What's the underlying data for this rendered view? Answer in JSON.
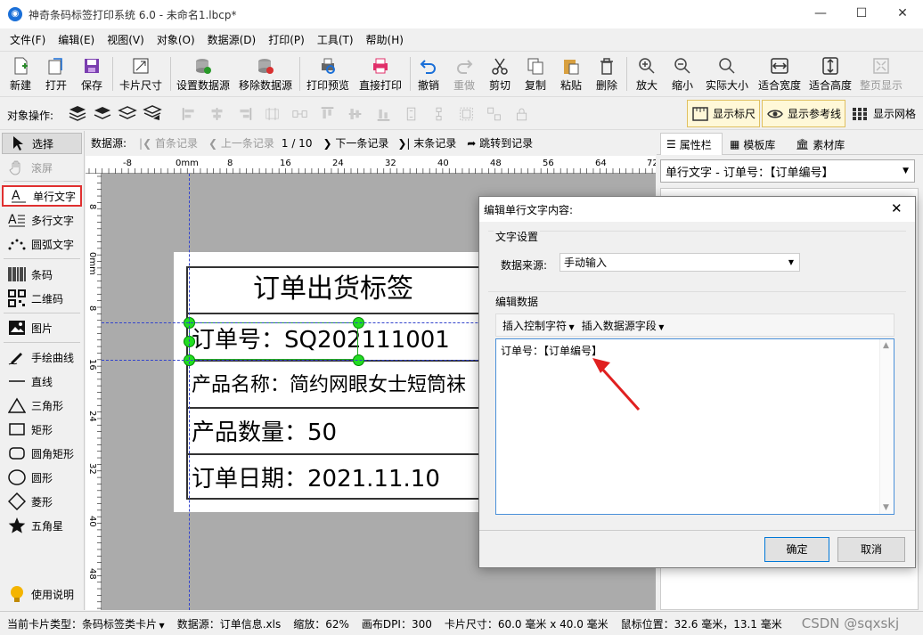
{
  "window": {
    "title": "神奇条码标签打印系统 6.0 - 未命名1.lbcp*",
    "minimize": "—",
    "maximize": "☐",
    "close": "✕"
  },
  "menu": [
    "文件(F)",
    "编辑(E)",
    "视图(V)",
    "对象(O)",
    "数据源(D)",
    "打印(P)",
    "工具(T)",
    "帮助(H)"
  ],
  "toolbar": {
    "new": "新建",
    "open": "打开",
    "save": "保存",
    "card_size": "卡片尺寸",
    "set_ds": "设置数据源",
    "remove_ds": "移除数据源",
    "print_preview": "打印预览",
    "direct_print": "直接打印",
    "undo": "撤销",
    "redo": "重做",
    "cut": "剪切",
    "copy": "复制",
    "paste": "粘贴",
    "delete": "删除",
    "zoom_in": "放大",
    "zoom_out": "缩小",
    "actual_size": "实际大小",
    "fit_width": "适合宽度",
    "fit_height": "适合高度",
    "fit_page": "整页显示"
  },
  "toolbar2": {
    "obj_ops": "对象操作:",
    "show_ruler": "显示标尺",
    "show_guides": "显示参考线",
    "show_grid": "显示网格"
  },
  "tools": {
    "select": "选择",
    "pan": "滚屏",
    "single_text": "单行文字",
    "multi_text": "多行文字",
    "arc_text": "圆弧文字",
    "barcode": "条码",
    "qrcode": "二维码",
    "image": "图片",
    "freehand": "手绘曲线",
    "line": "直线",
    "triangle": "三角形",
    "rect": "矩形",
    "round_rect": "圆角矩形",
    "circle": "圆形",
    "diamond": "菱形",
    "star": "五角星",
    "help": "使用说明"
  },
  "nav": {
    "ds_label": "数据源:",
    "first": "首条记录",
    "prev": "上一条记录",
    "page": "1 / 10",
    "next": "下一条记录",
    "last": "末条记录",
    "jump": "跳转到记录"
  },
  "hruler": {
    "unit": "0mm",
    "ticks": [
      "-8",
      "0mm",
      "8",
      "16",
      "24",
      "32",
      "40",
      "48",
      "56",
      "64",
      "72"
    ]
  },
  "vruler": {
    "unit": "0mm",
    "ticks": [
      "8",
      "0mm",
      "8",
      "16",
      "24",
      "32",
      "40",
      "48"
    ]
  },
  "label": {
    "title": "订单出货标签",
    "order": "订单号：SQ202111001",
    "product": "产品名称：简约网眼女士短筒袜",
    "qty": "产品数量：50",
    "date": "订单日期：2021.11.10"
  },
  "rightpanel": {
    "tab_props": "属性栏",
    "tab_templates": "模板库",
    "tab_assets": "素材库",
    "selected_object": "单行文字 - 订单号：【订单编号】"
  },
  "dialog": {
    "title": "编辑单行文字内容:",
    "section_text": "文字设置",
    "ds_label": "数据来源:",
    "ds_value": "手动输入",
    "section_edit": "编辑数据",
    "insert_ctrl": "插入控制字符",
    "insert_field": "插入数据源字段",
    "content": "订单号：【订单编号】",
    "ok": "确定",
    "cancel": "取消"
  },
  "status": {
    "card_type": "当前卡片类型：条码标签类卡片",
    "datasource": "数据源：订单信息.xls",
    "zoom": "缩放：62%",
    "dpi": "画布DPI：300",
    "card_size": "卡片尺寸：60.0 毫米 x 40.0 毫米",
    "mouse": "鼠标位置：32.6 毫米，13.1 毫米",
    "watermark": "CSDN @sqxskj"
  }
}
